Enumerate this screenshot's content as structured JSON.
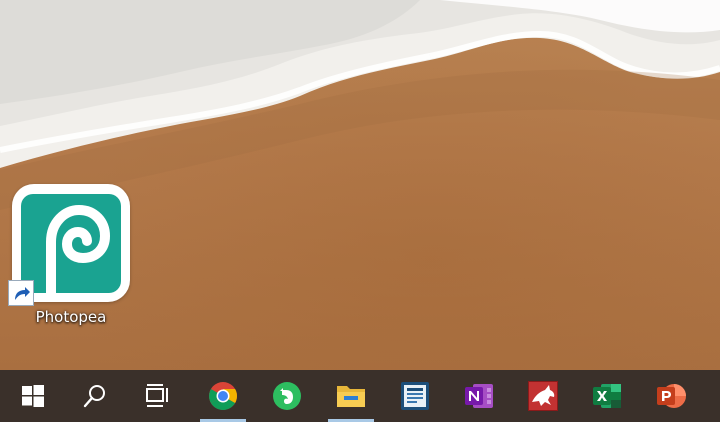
{
  "desktop": {
    "shortcuts": [
      {
        "label": "Photopea",
        "icon": "photopea-icon"
      }
    ]
  },
  "taskbar": {
    "items": [
      {
        "name": "start",
        "icon": "windows-logo-icon",
        "running": false
      },
      {
        "name": "search",
        "icon": "search-icon",
        "running": false
      },
      {
        "name": "task-view",
        "icon": "task-view-icon",
        "running": false
      },
      {
        "name": "chrome",
        "icon": "chrome-icon",
        "running": true
      },
      {
        "name": "evernote",
        "icon": "evernote-icon",
        "running": false
      },
      {
        "name": "file-explorer",
        "icon": "folder-icon",
        "running": true
      },
      {
        "name": "app-blue",
        "icon": "blue-app-icon",
        "running": false
      },
      {
        "name": "onenote",
        "icon": "onenote-icon",
        "running": false
      },
      {
        "name": "red-dragon",
        "icon": "red-dragon-app-icon",
        "running": false
      },
      {
        "name": "excel",
        "icon": "excel-icon",
        "running": false
      },
      {
        "name": "powerpoint",
        "icon": "powerpoint-icon",
        "running": false
      }
    ],
    "colors": {
      "background": "#3a302a",
      "running_indicator": "#a9c9e6"
    }
  }
}
